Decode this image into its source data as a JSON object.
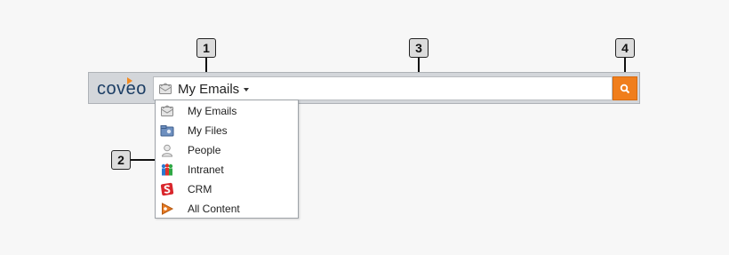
{
  "callouts": [
    "1",
    "2",
    "3",
    "4"
  ],
  "logo": {
    "text": "coveo"
  },
  "scope_selector": {
    "label": "My Emails",
    "icon": "envelope-icon"
  },
  "search_input": {
    "value": "",
    "placeholder": ""
  },
  "search_button": {
    "icon": "search-icon",
    "color": "#f07e1c"
  },
  "dropdown": {
    "items": [
      {
        "label": "My Emails",
        "icon": "envelope-icon"
      },
      {
        "label": "My Files",
        "icon": "folder-icon"
      },
      {
        "label": "People",
        "icon": "person-icon"
      },
      {
        "label": "Intranet",
        "icon": "intranet-icon"
      },
      {
        "label": "CRM",
        "icon": "crm-icon"
      },
      {
        "label": "All Content",
        "icon": "all-content-icon"
      }
    ]
  },
  "colors": {
    "accent": "#f07e1c",
    "logo": "#1b3d64",
    "bar": "#d3d6da"
  }
}
